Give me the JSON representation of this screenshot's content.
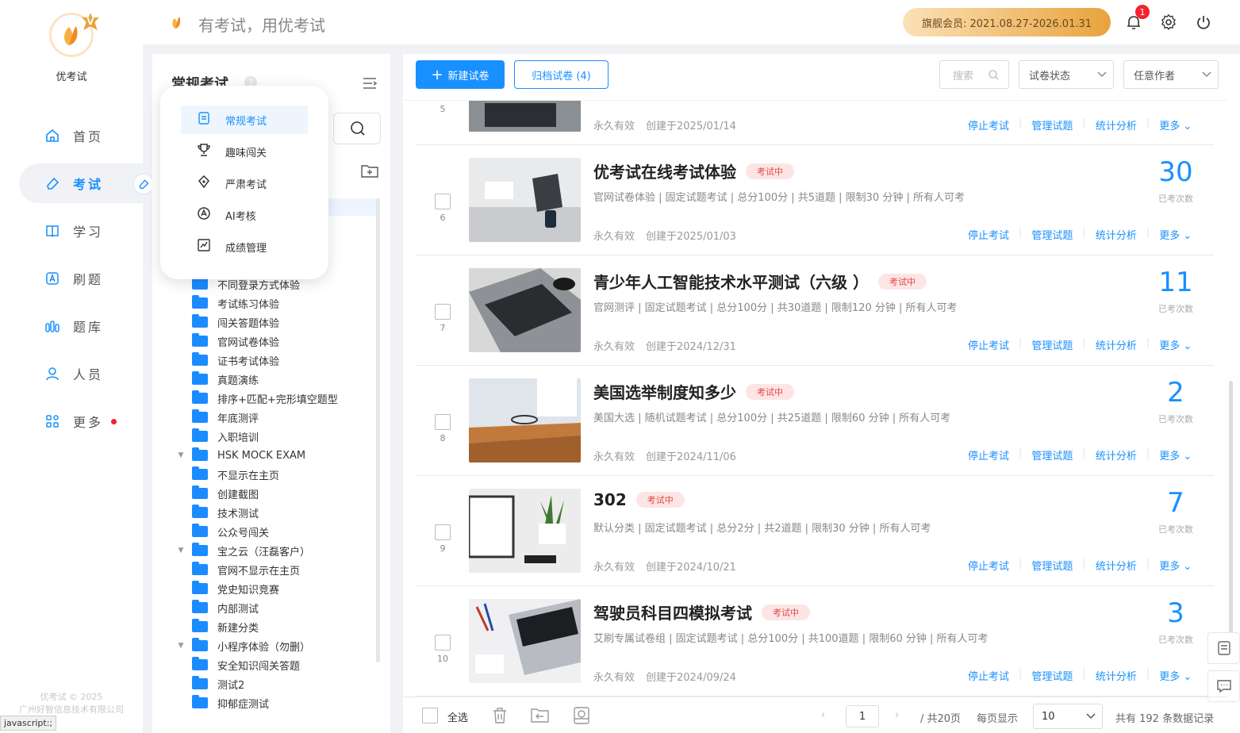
{
  "app": {
    "name": "优考试",
    "slogan": "有考试，用优考试",
    "badge": "V",
    "copyright_line1": "优考试 © 2025",
    "copyright_line2": "广州好智信息技术有限公司"
  },
  "status_text": "javascript:;",
  "nav": [
    {
      "label": "首页",
      "icon": "home-icon"
    },
    {
      "label": "考试",
      "icon": "eraser-icon",
      "active": true
    },
    {
      "label": "学习",
      "icon": "book-icon"
    },
    {
      "label": "刷题",
      "icon": "a-icon"
    },
    {
      "label": "题库",
      "icon": "bars-icon"
    },
    {
      "label": "人员",
      "icon": "person-icon"
    },
    {
      "label": "更多",
      "icon": "grid-icon",
      "dot": true
    }
  ],
  "header": {
    "member": "旗舰会员: 2021.08.27-2026.01.31",
    "notifications": "1"
  },
  "tree": {
    "title": "常规考试",
    "help": "?",
    "items": [
      {
        "label": "不同登录方式体验",
        "arrow": ""
      },
      {
        "label": "考试练习体验",
        "arrow": ""
      },
      {
        "label": "闯关答题体验",
        "arrow": ""
      },
      {
        "label": "官网试卷体验",
        "arrow": ""
      },
      {
        "label": "证书考试体验",
        "arrow": ""
      },
      {
        "label": "真题演练",
        "arrow": ""
      },
      {
        "label": "排序+匹配+完形填空题型",
        "arrow": ""
      },
      {
        "label": "年底测评",
        "arrow": ""
      },
      {
        "label": "入职培训",
        "arrow": ""
      },
      {
        "label": "HSK MOCK EXAM",
        "arrow": "▼"
      },
      {
        "label": "不显示在主页",
        "arrow": ""
      },
      {
        "label": "创建截图",
        "arrow": ""
      },
      {
        "label": "技术测试",
        "arrow": ""
      },
      {
        "label": "公众号闯关",
        "arrow": ""
      },
      {
        "label": "宝之云（汪磊客户）",
        "arrow": "▼"
      },
      {
        "label": "官网不显示在主页",
        "arrow": ""
      },
      {
        "label": "党史知识竞赛",
        "arrow": ""
      },
      {
        "label": "内部测试",
        "arrow": ""
      },
      {
        "label": "新建分类",
        "arrow": ""
      },
      {
        "label": "小程序体验（勿删）",
        "arrow": "▼"
      },
      {
        "label": "安全知识闯关答题",
        "arrow": ""
      },
      {
        "label": "测试2",
        "arrow": ""
      },
      {
        "label": "抑郁症测试",
        "arrow": ""
      }
    ]
  },
  "popup": [
    {
      "label": "常规考试",
      "icon": "document-icon",
      "active": true
    },
    {
      "label": "趣味闯关",
      "icon": "trophy-icon"
    },
    {
      "label": "严肃考试",
      "icon": "pen-nib-icon"
    },
    {
      "label": "AI考核",
      "icon": "ai-icon"
    },
    {
      "label": "成绩管理",
      "icon": "chart-icon"
    }
  ],
  "toolbar": {
    "new_label": "新建试卷",
    "archive_label": "归档试卷 (4)",
    "search_placeholder": "搜索",
    "status_select": "试卷状态",
    "author_select": "任意作者"
  },
  "partial_row": {
    "num": "5",
    "validity": "永久有效",
    "created": "创建于2025/01/14"
  },
  "actions": {
    "stop": "停止考试",
    "manage": "管理试题",
    "stats": "统计分析",
    "more": "更多",
    "sep": "|"
  },
  "count_label": "已考次数",
  "exams": [
    {
      "num": "6",
      "title": "优考试在线考试体验",
      "tag": "考试中",
      "desc": "官网试卷体验 | 固定试题考试 | 总分100分 | 共5道题 | 限制30 分钟 | 所有人可考",
      "validity": "永久有效",
      "created": "创建于2025/01/03",
      "count": "30"
    },
    {
      "num": "7",
      "title": "青少年人工智能技术水平测试（六级 ）",
      "tag": "考试中",
      "desc": "官网测评 | 固定试题考试 | 总分100分 | 共30道题 | 限制120 分钟 | 所有人可考",
      "validity": "永久有效",
      "created": "创建于2024/12/31",
      "count": "11"
    },
    {
      "num": "8",
      "title": "美国选举制度知多少",
      "tag": "考试中",
      "desc": "美国大选 | 随机试题考试 | 总分100分 | 共25道题 | 限制60 分钟 | 所有人可考",
      "validity": "永久有效",
      "created": "创建于2024/11/06",
      "count": "2"
    },
    {
      "num": "9",
      "title": "302",
      "tag": "考试中",
      "desc": "默认分类 | 固定试题考试 | 总分2分 | 共2道题 | 限制30 分钟 | 所有人可考",
      "validity": "永久有效",
      "created": "创建于2024/10/21",
      "count": "7"
    },
    {
      "num": "10",
      "title": "驾驶员科目四模拟考试",
      "tag": "考试中",
      "desc": "艾刷专属试卷组 | 固定试题考试 | 总分100分 | 共100道题 | 限制60 分钟 | 所有人可考",
      "validity": "永久有效",
      "created": "创建于2024/09/24",
      "count": "3"
    }
  ],
  "footer": {
    "select_all": "全选",
    "page": "1",
    "total_pages": "/ 共20页",
    "per_page_label": "每页显示",
    "per_page": "10",
    "total": "共有 192 条数据记录"
  },
  "colors": {
    "primary": "#1890ff",
    "tag_bg": "#fde5e5",
    "tag_text": "#e54545",
    "member_gold": "#e8a33d"
  }
}
